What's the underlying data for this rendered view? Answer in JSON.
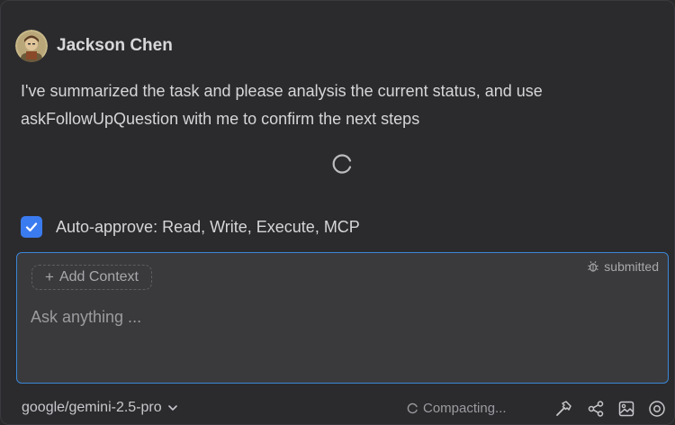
{
  "message": {
    "username": "Jackson Chen",
    "text": "I've summarized the task and please analysis the current status, and use askFollowUpQuestion with me to confirm the next steps"
  },
  "auto_approve": {
    "checked": true,
    "label": "Auto-approve: Read, Write, Execute, MCP"
  },
  "input": {
    "add_context_label": "Add Context",
    "status": "submitted",
    "placeholder": "Ask anything ..."
  },
  "footer": {
    "model": "google/gemini-2.5-pro",
    "status": "Compacting..."
  },
  "icons": {
    "spinner": "loading-spinner-icon",
    "bug": "bug-icon",
    "chevron": "chevron-down-icon",
    "hammer": "hammer-icon",
    "share": "share-icon",
    "image": "image-icon",
    "record": "record-icon"
  },
  "colors": {
    "accent_blue": "#3b7bf0",
    "focus_border": "#3a86d6",
    "background": "#2b2b2e",
    "input_background": "#3a3a3c"
  }
}
